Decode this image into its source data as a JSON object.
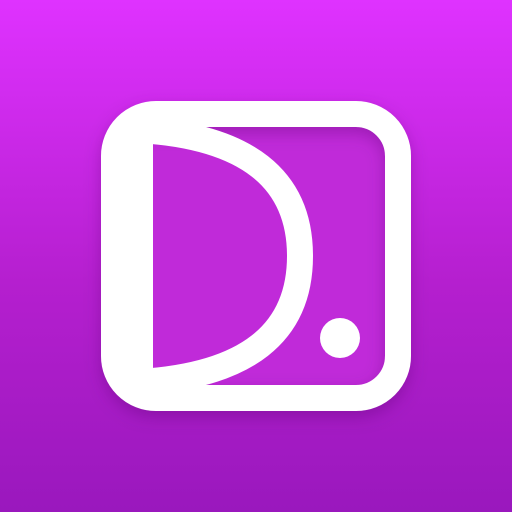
{
  "icon": {
    "name": "app-logo-icon",
    "colors": {
      "background_top": "#df32ff",
      "background_bottom": "#9a18bd",
      "foreground": "#ffffff",
      "inner_fill": "#c02ad9"
    }
  }
}
